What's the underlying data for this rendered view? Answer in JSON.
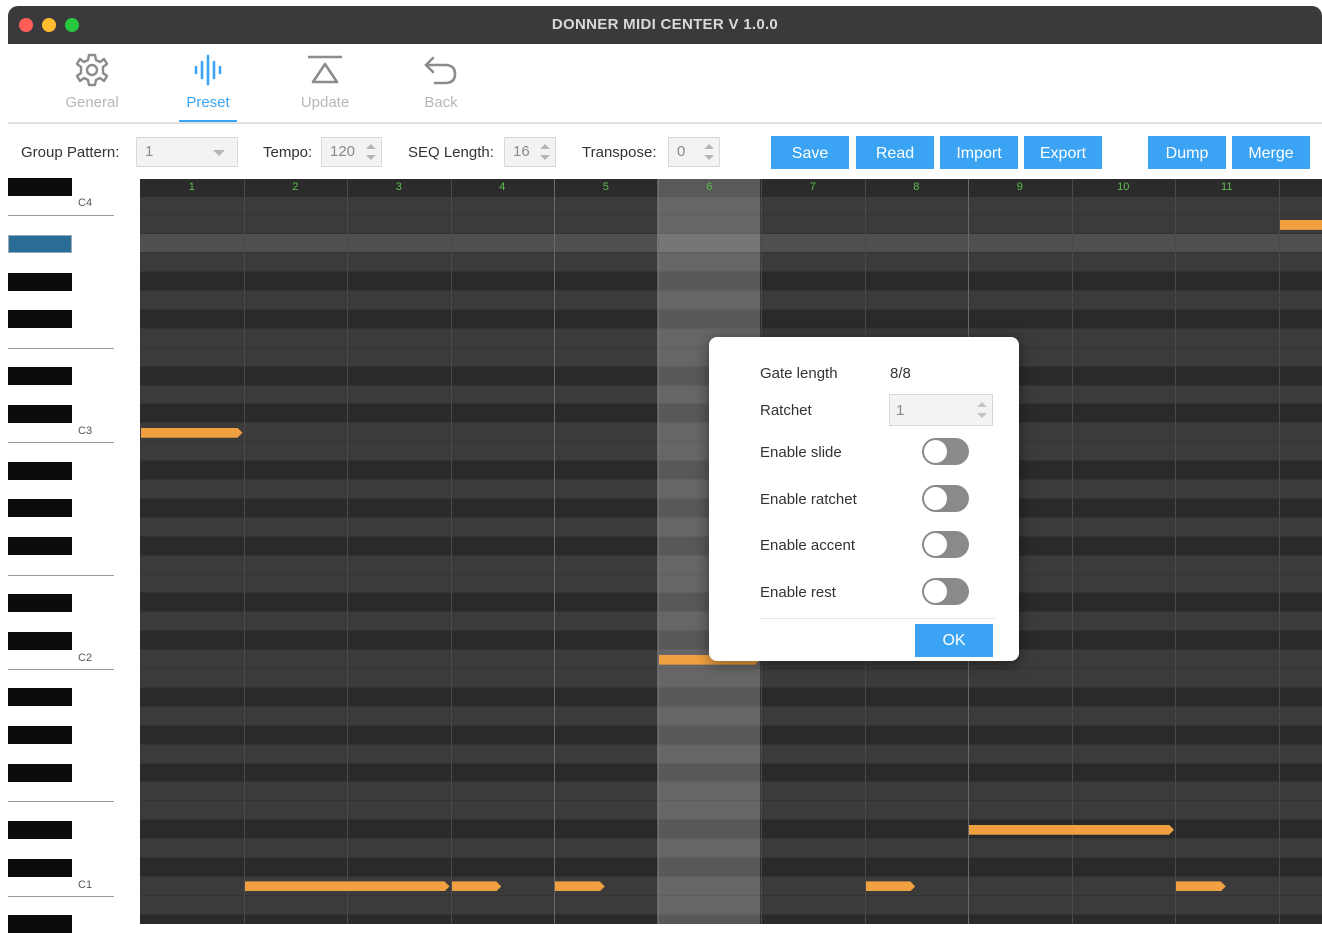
{
  "window": {
    "title": "DONNER MIDI CENTER V 1.0.0"
  },
  "toolbar": {
    "items": [
      {
        "label": "General",
        "icon": "gear-icon",
        "active": false
      },
      {
        "label": "Preset",
        "icon": "waveform-icon",
        "active": true
      },
      {
        "label": "Update",
        "icon": "upload-icon",
        "active": false
      },
      {
        "label": "Back",
        "icon": "undo-arrow-icon",
        "active": false
      }
    ]
  },
  "controls": {
    "group_pattern": {
      "label": "Group Pattern:",
      "value": "1"
    },
    "tempo": {
      "label": "Tempo:",
      "value": "120"
    },
    "seq_length": {
      "label": "SEQ Length:",
      "value": "16"
    },
    "transpose": {
      "label": "Transpose:",
      "value": "0"
    },
    "buttons": [
      "Save",
      "Read",
      "Import",
      "Export",
      "Dump",
      "Merge"
    ]
  },
  "keyboard": {
    "octave_labels": [
      "C4",
      "C3",
      "C2",
      "C1"
    ],
    "highlighted_key": "A#3"
  },
  "sequencer": {
    "step_numbers": [
      "1",
      "2",
      "3",
      "4",
      "5",
      "6",
      "7",
      "8",
      "9",
      "10",
      "11"
    ],
    "selected_step": 6,
    "notes": [
      {
        "step": 1,
        "length": 1,
        "pitch": "C3"
      },
      {
        "step": 2,
        "length": 2,
        "pitch": "C1"
      },
      {
        "step": 4,
        "length": 0.5,
        "pitch": "C1"
      },
      {
        "step": 5,
        "length": 0.5,
        "pitch": "C1"
      },
      {
        "step": 6,
        "length": 1,
        "pitch": "C2"
      },
      {
        "step": 8,
        "length": 0.5,
        "pitch": "C1"
      },
      {
        "step": 9,
        "length": 2,
        "pitch": "D#1"
      },
      {
        "step": 11,
        "length": 0.5,
        "pitch": "C1"
      },
      {
        "step": 12,
        "length": 0.5,
        "pitch": "B3"
      }
    ]
  },
  "dialog": {
    "gate_length": {
      "label": "Gate length",
      "value": "8/8"
    },
    "ratchet": {
      "label": "Ratchet",
      "value": "1"
    },
    "toggles": [
      {
        "label": "Enable slide",
        "on": false
      },
      {
        "label": "Enable ratchet",
        "on": false
      },
      {
        "label": "Enable accent",
        "on": false
      },
      {
        "label": "Enable rest",
        "on": false
      }
    ],
    "ok_label": "OK"
  },
  "colors": {
    "accent": "#3aa3f3",
    "note": "#f0a040",
    "grid_dark": "#2a2a2a",
    "grid_light": "#3a3a3a",
    "key_highlight": "#2a6c96"
  }
}
